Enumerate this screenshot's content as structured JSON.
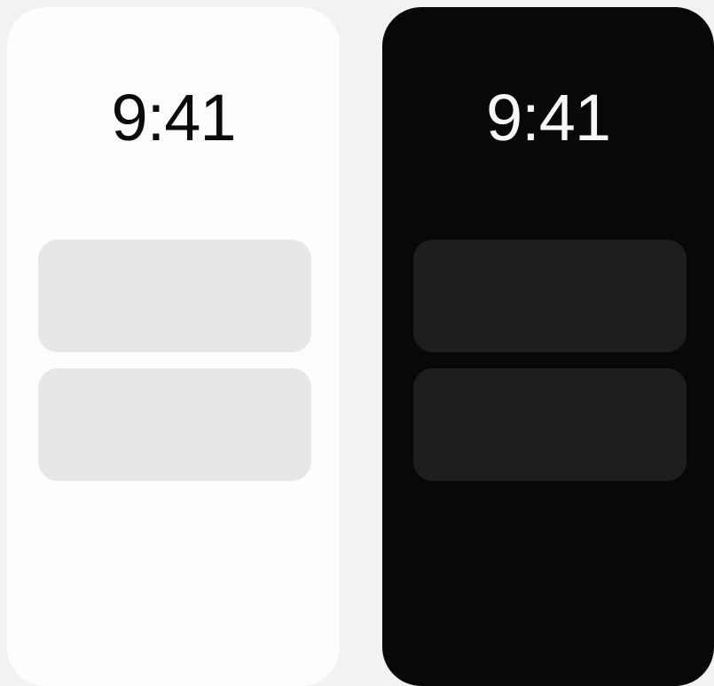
{
  "screens": [
    {
      "theme": "light",
      "clock": "9:41",
      "widgets": 2,
      "colors": {
        "background": "#fdfdfd",
        "widget": "#e6e7e6",
        "text": "#0b0b0b"
      }
    },
    {
      "theme": "dark",
      "clock": "9:41",
      "widgets": 2,
      "colors": {
        "background": "#070908",
        "widget": "#1d1e1d",
        "text": "#f7f7f7"
      }
    }
  ],
  "page": {
    "background": "#f2f2f2"
  }
}
